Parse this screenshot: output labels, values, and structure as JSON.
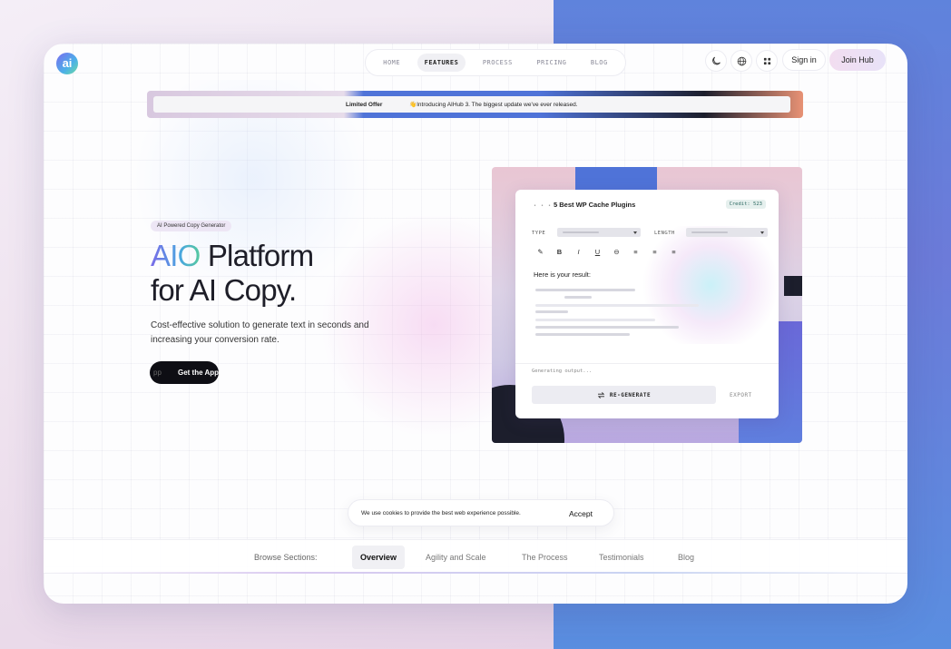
{
  "header": {
    "logo_text": "ai",
    "nav": [
      "HOME",
      "FEATURES",
      "PROCESS",
      "PRICING",
      "BLOG"
    ],
    "active_nav": "FEATURES",
    "icons": [
      "moon-icon",
      "globe-icon",
      "grid-icon"
    ],
    "signin_label": "Sign in",
    "join_label": "Join Hub"
  },
  "announcement": {
    "label": "Limited Offer",
    "text": "👋Introducing AIHub 3. The biggest update we've ever released."
  },
  "hero": {
    "badge": "AI Powered Copy Generator",
    "title_accent": "AIO",
    "title_rest": " Platform",
    "title_line2": "for AI Copy.",
    "subtitle": "Cost-effective solution to generate text in seconds and increasing your conversion rate.",
    "cta_ghost": "pp",
    "cta_label": "Get the App"
  },
  "editor": {
    "dots": "• • • •",
    "doc_title": "5 Best WP Cache Plugins",
    "credit": "Credit: 523",
    "type_label": "TYPE",
    "length_label": "LENGTH",
    "toolbar": [
      "pen-icon",
      "bold-icon",
      "italic-icon",
      "underline-icon",
      "link-icon",
      "align-left-icon",
      "align-center-icon",
      "align-right-icon"
    ],
    "toolbar_glyphs": [
      "✎",
      "B",
      "I",
      "U",
      "⊖",
      "≡",
      "≡",
      "≡"
    ],
    "result_label": "Here is your result:",
    "generating_text": "Generating output...",
    "regenerate_label": "RE-GENERATE",
    "export_label": "EXPORT"
  },
  "cookie": {
    "message": "We use cookies to provide the best web experience possible.",
    "accept_label": "Accept"
  },
  "browse": {
    "label": "Browse Sections:",
    "tabs": [
      "Overview",
      "Agility and Scale",
      "The Process",
      "Testimonials",
      "Blog"
    ],
    "active_tab": "Overview"
  }
}
